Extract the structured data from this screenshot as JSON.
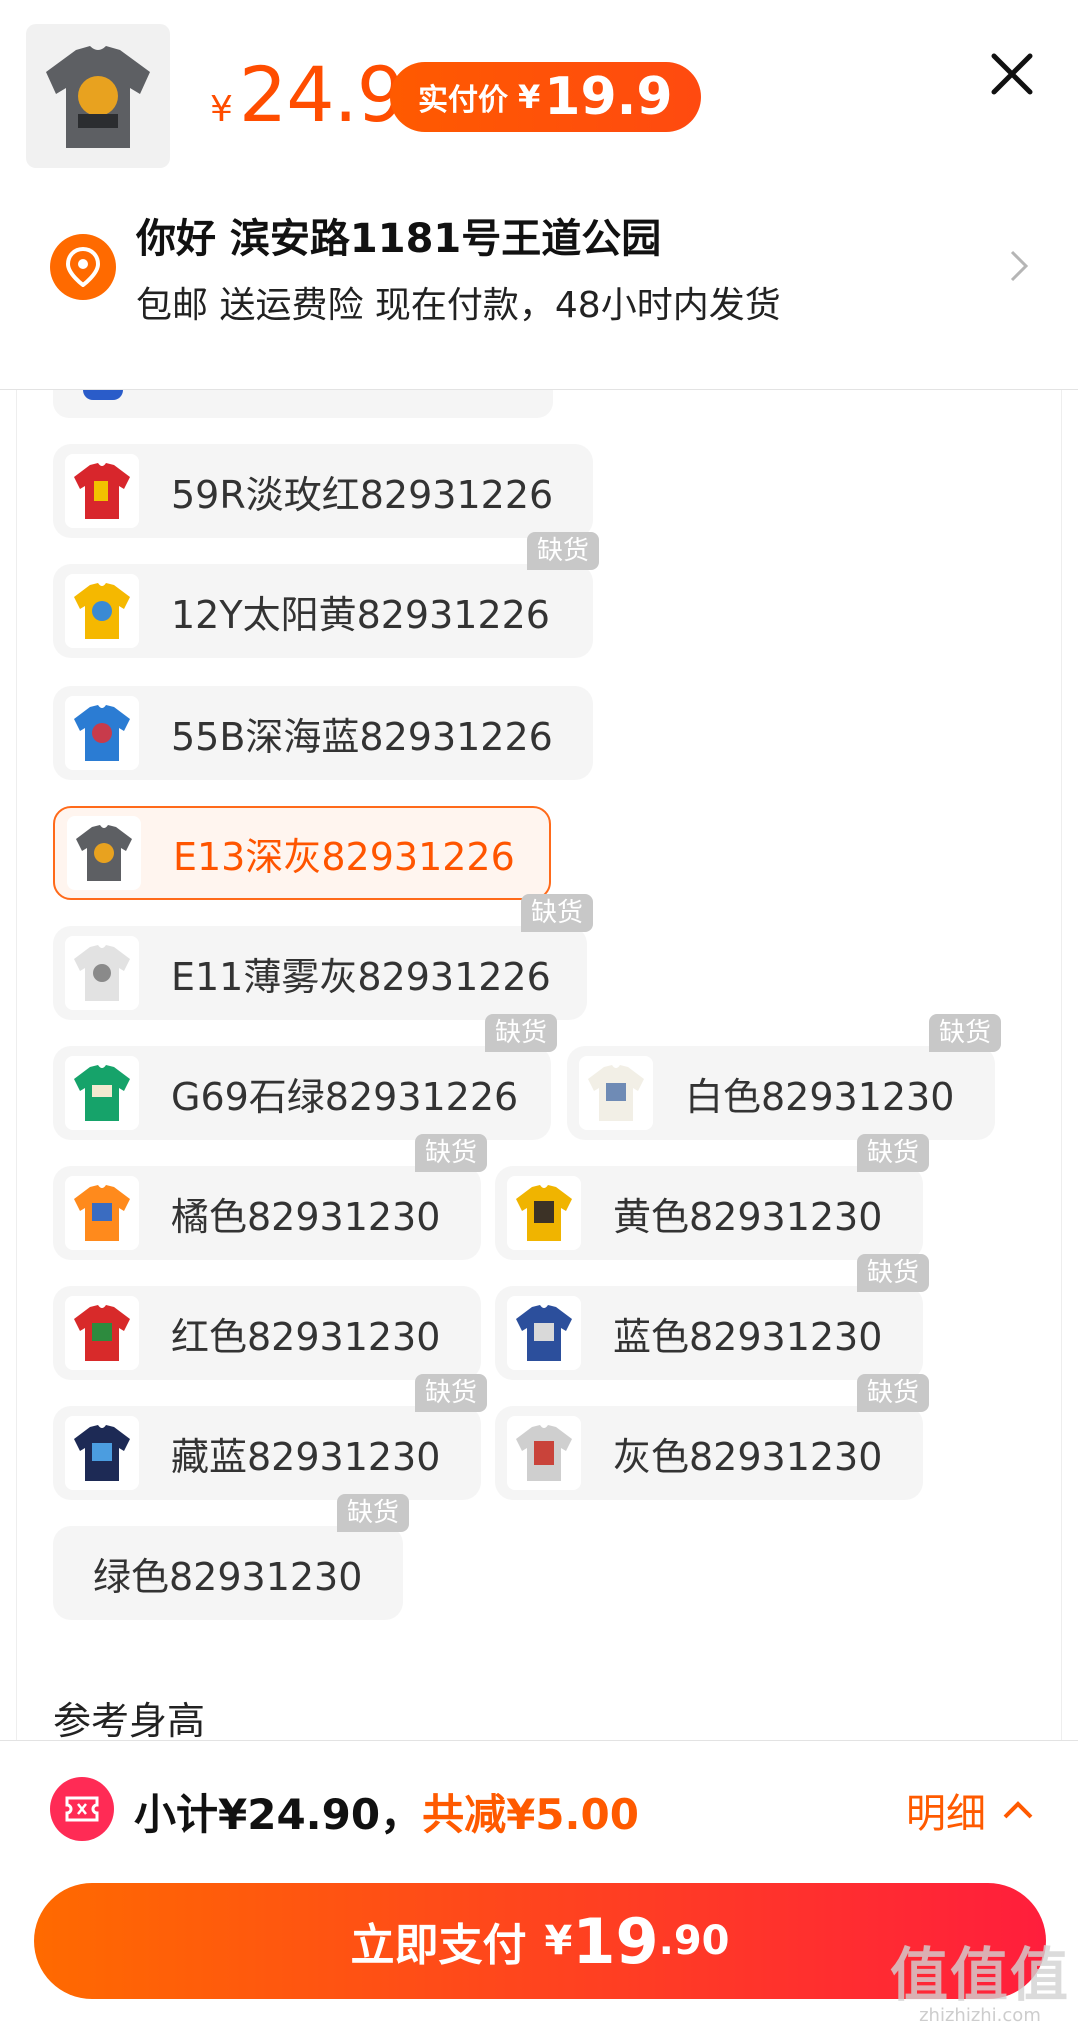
{
  "header": {
    "price_symbol": "¥",
    "price": "24.9",
    "pay_label": "实付价",
    "pay_symbol": "¥",
    "pay_price": "19.9"
  },
  "address": {
    "title": "你好 滨安路1181号王道公园",
    "subtitle": "包邮 送运费险 现在付款，48小时内发货"
  },
  "colors_section": {
    "items": [
      {
        "label": "59R淡玫红82931226",
        "out_of_stock": false
      },
      {
        "label": "12Y太阳黄82931226",
        "out_of_stock": true
      },
      {
        "label": "55B深海蓝82931226",
        "out_of_stock": false
      },
      {
        "label": "E13深灰82931226",
        "out_of_stock": false,
        "selected": true
      },
      {
        "label": "E11薄雾灰82931226",
        "out_of_stock": true
      },
      {
        "label": "G69石绿82931226",
        "out_of_stock": true
      },
      {
        "label": "白色82931230",
        "out_of_stock": true
      },
      {
        "label": "橘色82931230",
        "out_of_stock": true
      },
      {
        "label": "黄色82931230",
        "out_of_stock": true
      },
      {
        "label": "红色82931230",
        "out_of_stock": false
      },
      {
        "label": "蓝色82931230",
        "out_of_stock": true
      },
      {
        "label": "藏蓝82931230",
        "out_of_stock": true
      },
      {
        "label": "灰色82931230",
        "out_of_stock": true
      },
      {
        "label": "绿色82931230",
        "out_of_stock": true
      }
    ],
    "out_of_stock_label": "缺货"
  },
  "size_section": {
    "title": "参考身高"
  },
  "footer": {
    "subtotal": "小计¥24.90，",
    "discount": "共减¥5.00",
    "detail_label": "明细",
    "pay_label": "立即支付",
    "pay_symbol": "¥",
    "pay_int": "19",
    "pay_dec": ".90"
  },
  "watermark": {
    "logo": "值值值",
    "url": "zhizhizhi.com"
  },
  "theme": {
    "accent": "#ff5a00",
    "selected_border": "#ff6a1a",
    "oos_badge": "#c8c8c8",
    "chip_bg": "#f5f5f5"
  }
}
